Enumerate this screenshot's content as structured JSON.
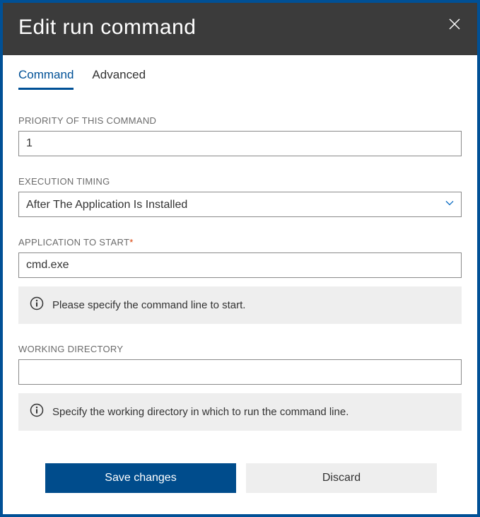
{
  "header": {
    "title": "Edit run command"
  },
  "tabs": {
    "command": "Command",
    "advanced": "Advanced"
  },
  "fields": {
    "priority": {
      "label": "PRIORITY OF THIS COMMAND",
      "value": "1"
    },
    "timing": {
      "label": "EXECUTION TIMING",
      "value": "After The Application Is Installed"
    },
    "application": {
      "label": "APPLICATION TO START",
      "value": "cmd.exe",
      "hint": "Please specify the command line to start."
    },
    "workdir": {
      "label": "WORKING DIRECTORY",
      "value": "",
      "hint": "Specify the working directory in which to run the command line."
    }
  },
  "buttons": {
    "save": "Save changes",
    "discard": "Discard"
  }
}
